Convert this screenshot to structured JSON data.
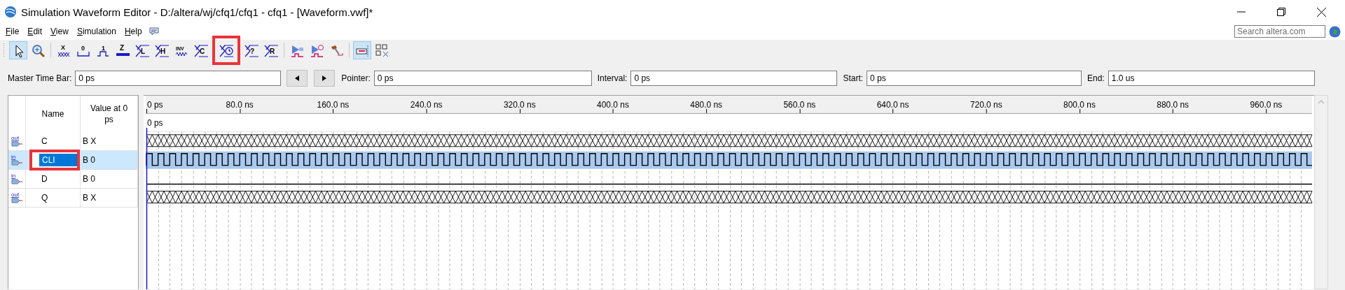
{
  "window": {
    "title": "Simulation Waveform Editor - D:/altera/wj/cfq1/cfq1 - cfq1 - [Waveform.vwf]*"
  },
  "menu": [
    "File",
    "Edit",
    "View",
    "Simulation",
    "Help"
  ],
  "search": {
    "placeholder": "Search altera.com"
  },
  "toolbar": [
    {
      "tools": [
        {
          "kind": "pointer",
          "selected": true,
          "annotated": false
        },
        {
          "kind": "zoom",
          "selected": false,
          "annotated": false
        }
      ]
    },
    {
      "tools": [
        {
          "kind": "unknown",
          "glyph": "X",
          "selected": false,
          "annotated": false
        },
        {
          "kind": "low",
          "glyph": "0",
          "selected": false,
          "annotated": false
        },
        {
          "kind": "high",
          "glyph": "1",
          "selected": false,
          "annotated": false
        },
        {
          "kind": "highz",
          "glyph": "Z",
          "selected": false,
          "annotated": false
        },
        {
          "kind": "bus-letter",
          "glyph": "L",
          "selected": false,
          "annotated": false
        },
        {
          "kind": "bus-letter",
          "glyph": "H",
          "selected": false,
          "annotated": false
        },
        {
          "kind": "invert",
          "glyph": "INV",
          "selected": false,
          "annotated": false
        },
        {
          "kind": "bus-letter",
          "glyph": "C",
          "selected": false,
          "annotated": false
        },
        {
          "kind": "clock",
          "selected": false,
          "annotated": true
        },
        {
          "kind": "bus-letter",
          "glyph": "?",
          "selected": false,
          "annotated": false
        },
        {
          "kind": "bus-letter",
          "glyph": "R",
          "selected": false,
          "annotated": false
        }
      ]
    },
    {
      "tools": [
        {
          "kind": "run",
          "selected": false,
          "annotated": false
        },
        {
          "kind": "run-timer",
          "selected": false,
          "annotated": false
        },
        {
          "kind": "hammer",
          "selected": false,
          "annotated": false
        }
      ]
    },
    {
      "tools": [
        {
          "kind": "snap",
          "selected": true,
          "annotated": false
        },
        {
          "kind": "arrange",
          "selected": false,
          "annotated": false
        }
      ]
    }
  ],
  "time_bar": [
    {
      "label": "Master Time Bar:",
      "value": "0 ps"
    },
    {
      "label": "Pointer:",
      "value": "0 ps"
    },
    {
      "label": "Interval:",
      "value": "0 ps"
    },
    {
      "label": "Start:",
      "value": "0 ps"
    },
    {
      "label": "End:",
      "value": "1.0 us"
    }
  ],
  "table": {
    "columns": [
      "Name",
      "Value at 0 ps"
    ],
    "signals": [
      {
        "direction": "out",
        "name": "C",
        "value": "B X",
        "kind": "unknown",
        "selected": false,
        "annotated": false
      },
      {
        "direction": "in",
        "name": "CLI",
        "value": "B 0",
        "kind": "clock",
        "selected": true,
        "annotated": true
      },
      {
        "direction": "in",
        "name": "D",
        "value": "B 0",
        "kind": "low",
        "selected": false,
        "annotated": false
      },
      {
        "direction": "out",
        "name": "Q",
        "value": "B X",
        "kind": "unknown",
        "selected": false,
        "annotated": false
      }
    ]
  },
  "ruler": {
    "ticks": [
      "0 ps",
      "80.0 ns",
      "160.0 ns",
      "240.0 ns",
      "320.0 ns",
      "400.0 ns",
      "480.0 ns",
      "560.0 ns",
      "640.0 ns",
      "720.0 ns",
      "800.0 ns",
      "880.0 ns",
      "960.0 ns"
    ],
    "pointer_label": "0 ps"
  }
}
